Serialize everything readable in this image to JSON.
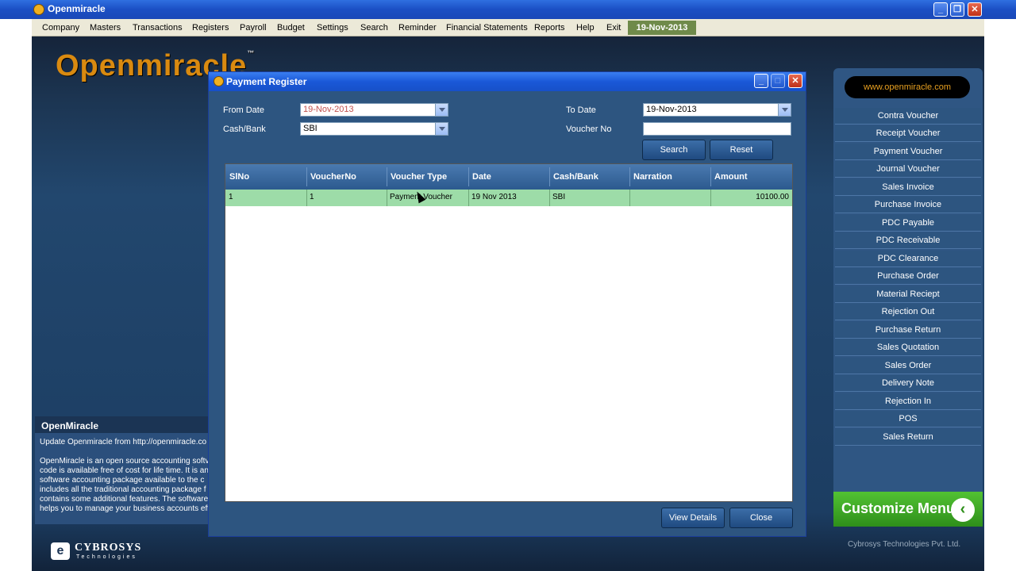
{
  "app": {
    "title": "Openmiracle"
  },
  "menu": {
    "items": [
      "Company",
      "Masters",
      "Transactions",
      "Registers",
      "Payroll",
      "Budget",
      "Settings",
      "Search",
      "Reminder",
      "Financial Statements",
      "Reports",
      "Help",
      "Exit"
    ],
    "date": "19-Nov-2013"
  },
  "brand": {
    "logo": "Openmiracle",
    "tm": "™"
  },
  "info_panel": {
    "title": "OpenMiracle",
    "update": "Update Openmiracle from http://openmiracle.co",
    "lines": [
      "OpenMiracle is an open source accounting softv",
      "code is available free of cost for life time. It is an",
      "software accounting package available to the c",
      "includes all the traditional accounting package f",
      "contains some additional features. The software",
      "helps you to manage your business accounts eff"
    ]
  },
  "footer": {
    "company": "CYBROSYS",
    "company_sub": "Technologies",
    "credit": "Cybrosys Technologies Pvt. Ltd."
  },
  "sidebar": {
    "website": "www.openmiracle.com",
    "items": [
      "Contra Voucher",
      "Receipt Voucher",
      "Payment Voucher",
      "Journal Voucher",
      "Sales Invoice",
      "Purchase Invoice",
      "PDC Payable",
      "PDC Receivable",
      "PDC Clearance",
      "Purchase Order",
      "Material Reciept",
      "Rejection Out",
      "Purchase Return",
      "Sales Quotation",
      "Sales Order",
      "Delivery Note",
      "Rejection In",
      "POS",
      "Sales Return"
    ],
    "customize": "Customize Menu"
  },
  "dialog": {
    "title": "Payment Register",
    "from_date_label": "From Date",
    "from_date_value": "19-Nov-2013",
    "to_date_label": "To Date",
    "to_date_value": "19-Nov-2013",
    "cash_bank_label": "Cash/Bank",
    "cash_bank_value": "SBI",
    "voucher_no_label": "Voucher No",
    "voucher_no_value": "",
    "search_label": "Search",
    "reset_label": "Reset",
    "view_details_label": "View Details",
    "close_label": "Close",
    "grid": {
      "columns": [
        "SlNo",
        "VoucherNo",
        "Voucher Type",
        "Date",
        "Cash/Bank",
        "Narration",
        "Amount"
      ],
      "rows": [
        [
          "1",
          "1",
          "Payment Voucher",
          "19 Nov 2013",
          "SBI",
          "",
          "10100.00"
        ]
      ]
    }
  },
  "colors": {
    "accent": "#1a58d8",
    "selected_row": "#9ddca8",
    "customize": "#3ea826"
  }
}
